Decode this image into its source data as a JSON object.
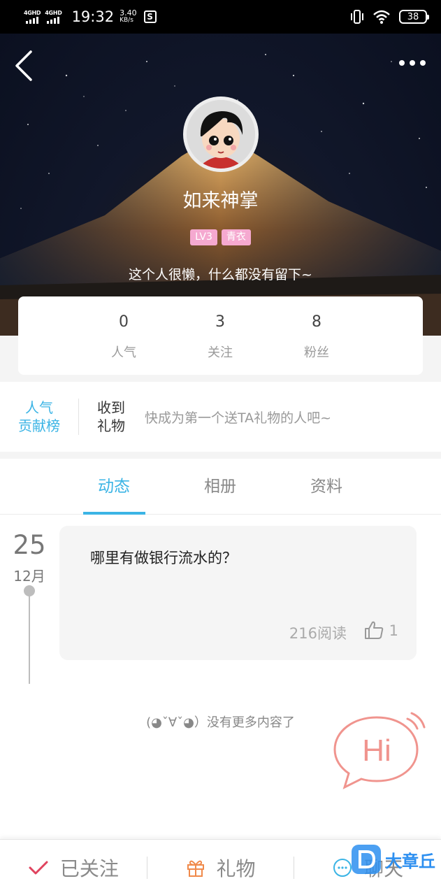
{
  "status_bar": {
    "signal1": "4GHD",
    "signal2": "4GHD",
    "time": "19:32",
    "speed_value": "3.40",
    "speed_unit": "KB/s",
    "battery": "38"
  },
  "profile": {
    "nickname": "如来神掌",
    "badges": [
      "LV3",
      "青衣"
    ],
    "bio": "这个人很懒，什么都没有留下~"
  },
  "stats": [
    {
      "value": "0",
      "label": "人气"
    },
    {
      "value": "3",
      "label": "关注"
    },
    {
      "value": "8",
      "label": "粉丝"
    }
  ],
  "gifts": {
    "rank_line1": "人气",
    "rank_line2": "贡献榜",
    "received_line1": "收到",
    "received_line2": "礼物",
    "hint": "快成为第一个送TA礼物的人吧~"
  },
  "tabs": [
    "动态",
    "相册",
    "资料"
  ],
  "feed": {
    "day": "25",
    "month": "12月",
    "post_text": "哪里有做银行流水的？",
    "reads": "216阅读",
    "likes": "1",
    "end_message": "(◕ˇ∀ˇ◕）没有更多内容了"
  },
  "hi_bubble": "Hi",
  "bottom_bar": {
    "follow": "已关注",
    "gift": "礼物",
    "chat": "聊天"
  },
  "watermark": "大章丘",
  "colors": {
    "accent": "#3bb4e5",
    "follow_check": "#e0435e",
    "gift_icon": "#f08a4b",
    "badge": "#f5a9d0",
    "hi_bubble": "#f0948e"
  }
}
